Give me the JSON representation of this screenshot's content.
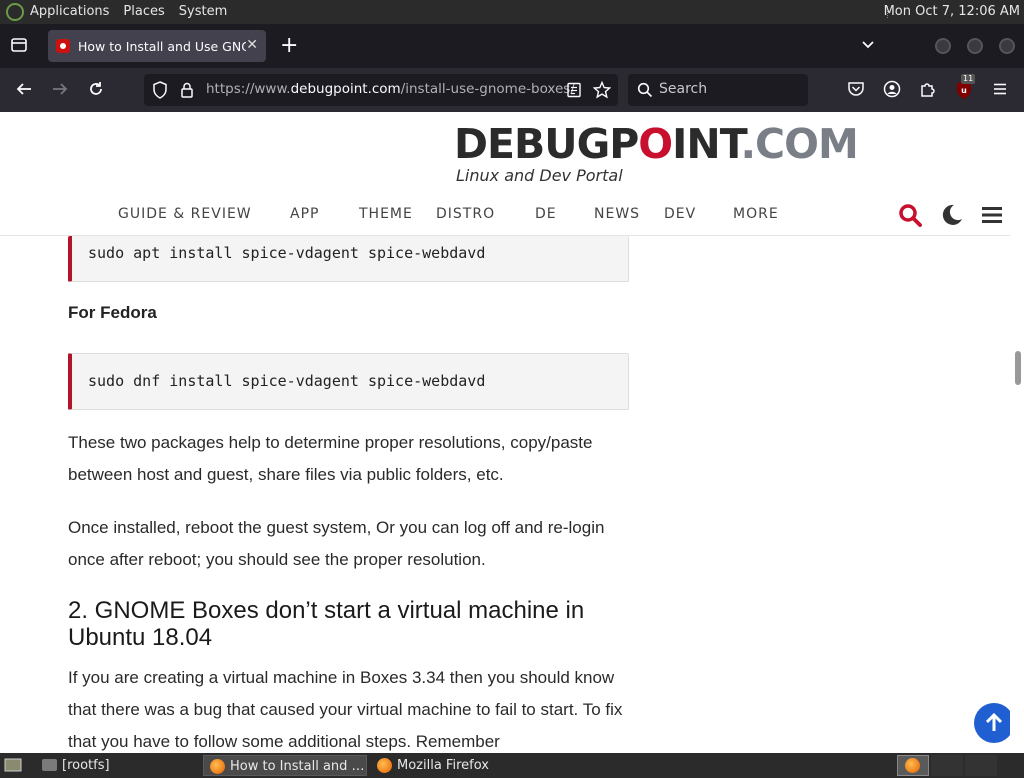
{
  "system_panel": {
    "menus": [
      "Applications",
      "Places",
      "System"
    ],
    "clock": "Mon Oct  7, 12:06 AM"
  },
  "browser": {
    "tab": {
      "title": "How to Install and Use GNOME Boxes",
      "close_glyph": "✕"
    },
    "new_tab_glyph": "+",
    "url": {
      "prefix": "https://www.",
      "domain": "debugpoint.com",
      "path": "/install-use-gnome-boxes/"
    },
    "search_placeholder": "Search",
    "ublock_badge": "11"
  },
  "site": {
    "logo": {
      "part1": "DEBUGP",
      "part2": "O",
      "part3": "INT",
      "part4": ".COM",
      "tagline": "Linux and Dev Portal"
    },
    "nav": [
      "GUIDE & REVIEW",
      "APP",
      "THEME",
      "DISTRO",
      "DE",
      "NEWS",
      "DEV",
      "MORE"
    ]
  },
  "article": {
    "code1": "sudo apt install spice-vdagent spice-webdavd",
    "fedora_heading": "For Fedora",
    "code2": "sudo dnf install spice-vdagent spice-webdavd",
    "para1": "These two packages help to determine proper resolutions, copy/paste between host and guest, share files via public folders, etc.",
    "para2": "Once installed, reboot the guest system, Or you can log off and re-login once after reboot; you should see the proper resolution.",
    "heading2": "2. GNOME Boxes don’t start a virtual machine in Ubuntu 18.04",
    "para3": "If you are creating a virtual machine in Boxes 3.34 then you should know that there was a bug that caused your virtual machine to fail to start. To fix that you have to follow some additional steps. Remember"
  },
  "taskbar": {
    "items": [
      "[rootfs]",
      "How to Install and …",
      "Mozilla Firefox"
    ]
  },
  "colors": {
    "accent_red": "#c8102e",
    "to_top_blue": "#1f5fd1"
  }
}
